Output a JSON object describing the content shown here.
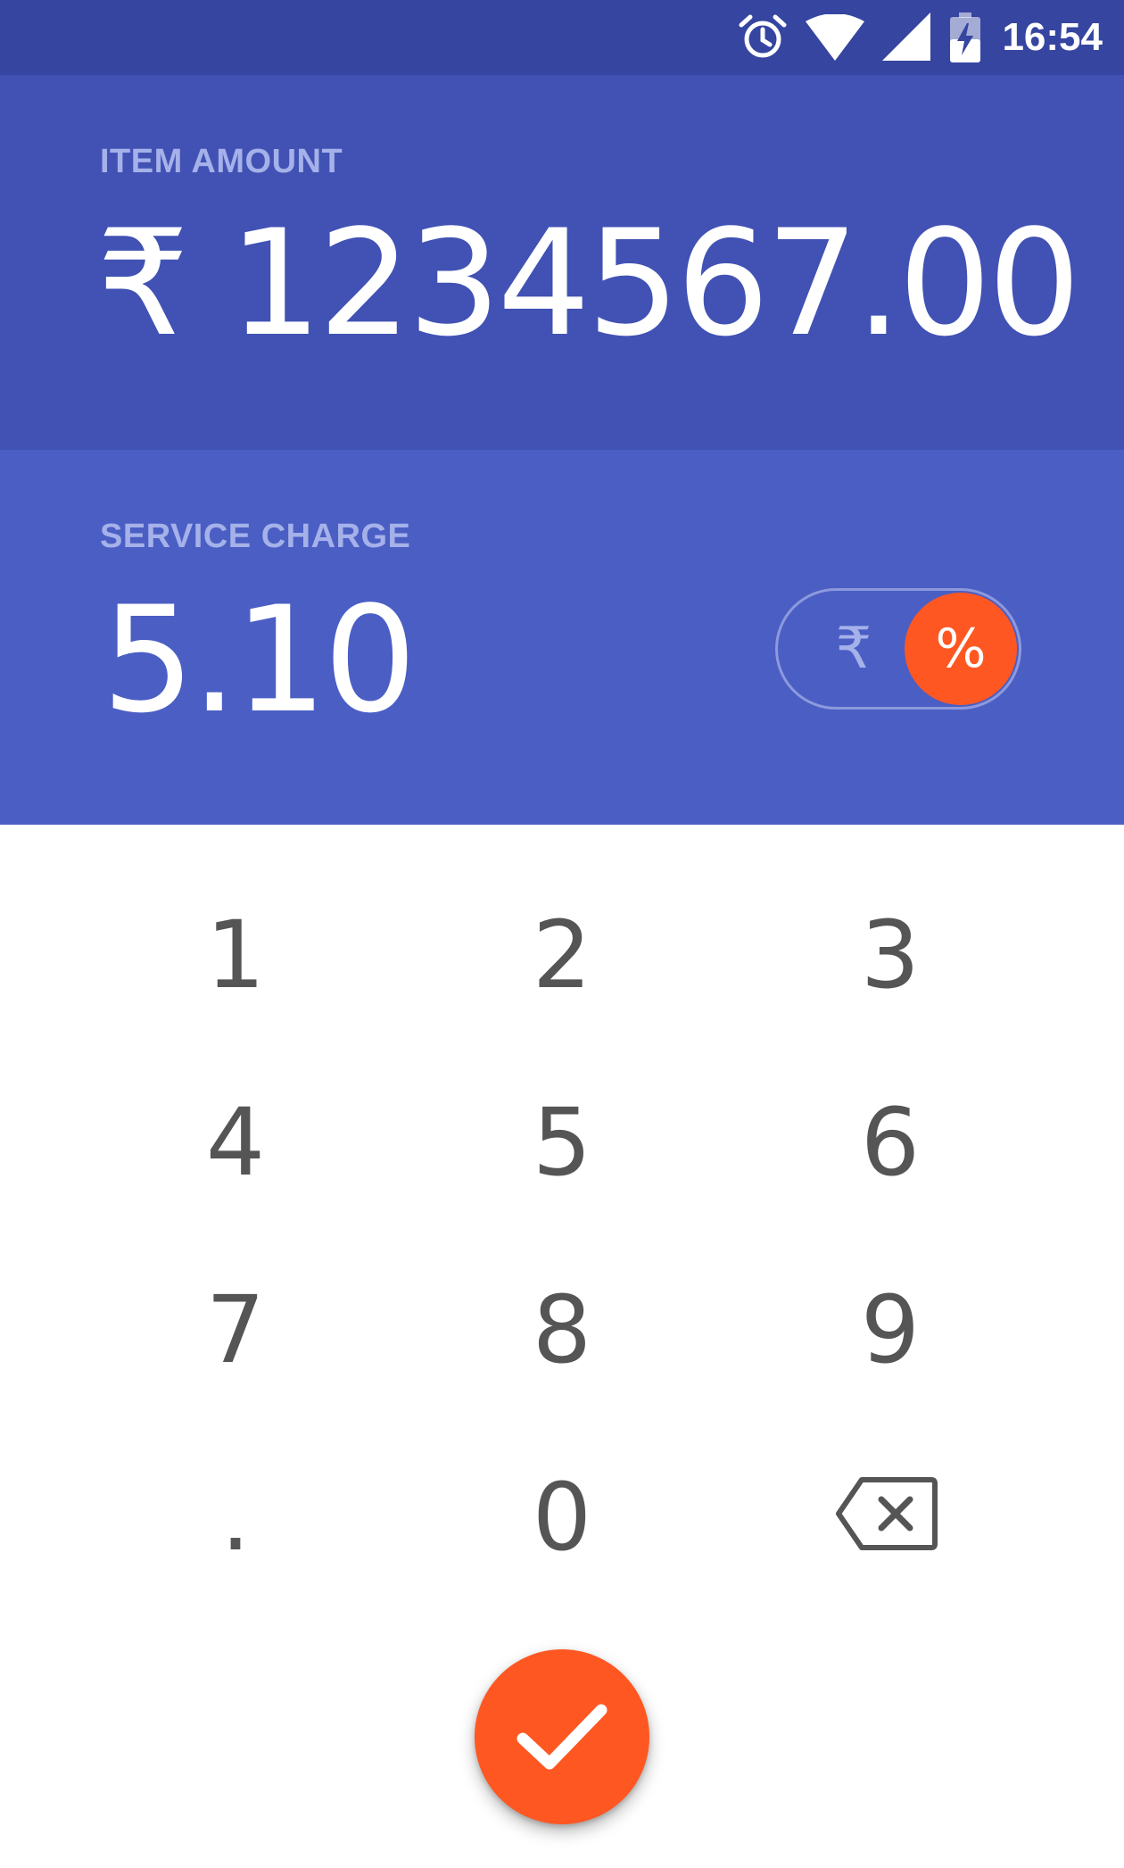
{
  "status_bar": {
    "time": "16:54",
    "icons": [
      "alarm-icon",
      "wifi-icon",
      "signal-icon",
      "battery-charging-icon"
    ]
  },
  "item_amount": {
    "label": "ITEM AMOUNT",
    "value": "₹ 1234567.00"
  },
  "service_charge": {
    "label": "SERVICE CHARGE",
    "value": "5.10",
    "toggle": {
      "rupee_label": "₹",
      "percent_label": "%",
      "selected": "percent"
    }
  },
  "keypad": {
    "keys": [
      "1",
      "2",
      "3",
      "4",
      "5",
      "6",
      "7",
      "8",
      "9",
      ".",
      "0"
    ],
    "backspace_icon": "backspace-icon"
  },
  "confirm": {
    "icon": "check-icon"
  },
  "colors": {
    "status_bar": "#3545a0",
    "item_panel": "#4152b4",
    "service_panel": "#4b5ec4",
    "accent": "#ff5722",
    "label": "#a5b1e9",
    "key_text": "#555555"
  }
}
